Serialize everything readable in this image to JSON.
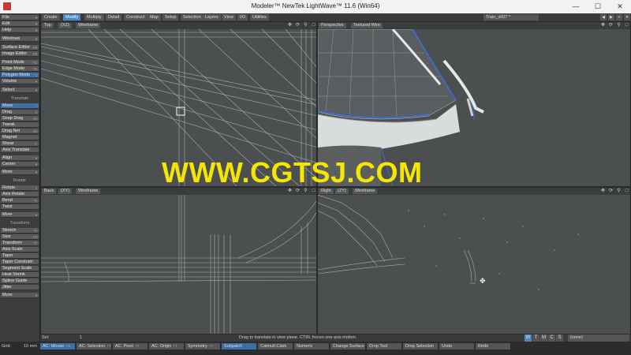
{
  "window": {
    "title": "Modeler™ NewTek LightWave™ 11.6 (Win64)",
    "minimize": "—",
    "maximize": "☐",
    "close": "✕"
  },
  "menu_tabs": [
    "Create",
    "Modify",
    "Multiply",
    "Detail",
    "Construct",
    "Map",
    "Setup",
    "Selection",
    "Layers",
    "View",
    "I/O",
    "Utilities"
  ],
  "active_tab": "Modify",
  "layer_dropdown": "Train_v007 *",
  "toolbar": {
    "top": [
      {
        "label": "File",
        "sc": "▾"
      },
      {
        "label": "Edit",
        "sc": "▾"
      },
      {
        "label": "Help",
        "sc": "▾"
      },
      {
        "label": "Windows",
        "sc": "▾"
      },
      {
        "label": "Surface Editor",
        "sc": "F5"
      },
      {
        "label": "Image Editor",
        "sc": "F6"
      },
      {
        "label": "Point Mode",
        "sc": "^G"
      },
      {
        "label": "Edge Mode",
        "sc": "^H"
      },
      {
        "label": "Polygon Mode",
        "sc": "^J"
      },
      {
        "label": "Volume",
        "sc": "▾"
      },
      {
        "label": "Select",
        "sc": "▾"
      }
    ],
    "translate_header": "Translate",
    "translate": [
      {
        "label": "Move",
        "sc": "t"
      },
      {
        "label": "Drag",
        "sc": "^t"
      },
      {
        "label": "Snap Drag",
        "sc": "+G"
      },
      {
        "label": "Tweak",
        "sc": ""
      },
      {
        "label": "Drag Net",
        "sc": "+G"
      },
      {
        "label": "Magnet",
        "sc": ""
      },
      {
        "label": "Shear",
        "sc": "Y"
      },
      {
        "label": "Axis Translate",
        "sc": ""
      },
      {
        "label": "Align",
        "sc": "▾"
      },
      {
        "label": "Center",
        "sc": "▾"
      },
      {
        "label": "More",
        "sc": "▾"
      }
    ],
    "rotate_header": "Rotate",
    "rotate": [
      {
        "label": "Rotate",
        "sc": "y"
      },
      {
        "label": "Axis Rotate",
        "sc": ""
      },
      {
        "label": "Bend",
        "sc": "^y"
      },
      {
        "label": "Twist",
        "sc": ""
      },
      {
        "label": "More",
        "sc": "▾"
      }
    ],
    "transform_header": "Transform",
    "transform": [
      {
        "label": "Stretch",
        "sc": "^h"
      },
      {
        "label": "Size",
        "sc": "+H"
      },
      {
        "label": "Transform",
        "sc": "^T"
      },
      {
        "label": "Axis Scale",
        "sc": ""
      },
      {
        "label": "Taper",
        "sc": ""
      },
      {
        "label": "Taper Constrain",
        "sc": ""
      },
      {
        "label": "Segment Scale",
        "sc": ""
      },
      {
        "label": "Heat Shrink",
        "sc": ""
      },
      {
        "label": "Spline Guide",
        "sc": ""
      },
      {
        "label": "Jitter",
        "sc": ""
      },
      {
        "label": "More",
        "sc": "▾"
      }
    ]
  },
  "selected_tool": "Move",
  "selected_mode": "Polygon Mode",
  "viewports": {
    "top_left": {
      "view": "Top",
      "axis": "(XZ)",
      "shading": "Wireframe"
    },
    "top_right": {
      "view": "Perspective",
      "axis": "",
      "shading": "Textured Wire"
    },
    "bottom_left": {
      "view": "Back",
      "axis": "(XY)",
      "shading": "Wireframe"
    },
    "bottom_right": {
      "view": "Right",
      "axis": "(ZY)",
      "shading": "Wireframe"
    }
  },
  "watermark": "WWW.CGTSJ.COM",
  "status": {
    "sel_label": "Sel:",
    "sel_value": "1",
    "hint": "Drag to translate in view plane. CTRL forces one axis motion.",
    "wtmcs": [
      "W",
      "T",
      "M",
      "C",
      "S"
    ],
    "surface": "(none)"
  },
  "bottom": {
    "grid_label": "Grid:",
    "grid_value": "10 mm",
    "items": [
      {
        "label": "AC: Mouse",
        "sc": "+R"
      },
      {
        "label": "AC: Selection",
        "sc": "+T"
      },
      {
        "label": "AC: Pivot",
        "sc": "+T"
      },
      {
        "label": "AC: Origin",
        "sc": "+T"
      },
      {
        "label": "Symmetry",
        "sc": "+Y"
      },
      {
        "label": "Subpatch",
        "sc": ""
      },
      {
        "label": "Catmull-Clark",
        "sc": ""
      },
      {
        "label": "Numeric",
        "sc": ""
      },
      {
        "label": "Change Surface",
        "sc": ""
      },
      {
        "label": "Drop Tool",
        "sc": ""
      },
      {
        "label": "Drop Selection",
        "sc": ""
      },
      {
        "label": "Undo",
        "sc": ""
      },
      {
        "label": "Redo",
        "sc": ""
      }
    ]
  },
  "colors": {
    "accent": "#4d86c4",
    "selected_button": "#3b6fa5",
    "viewport_bg": "#4b4f4f",
    "watermark": "#f4e600"
  }
}
